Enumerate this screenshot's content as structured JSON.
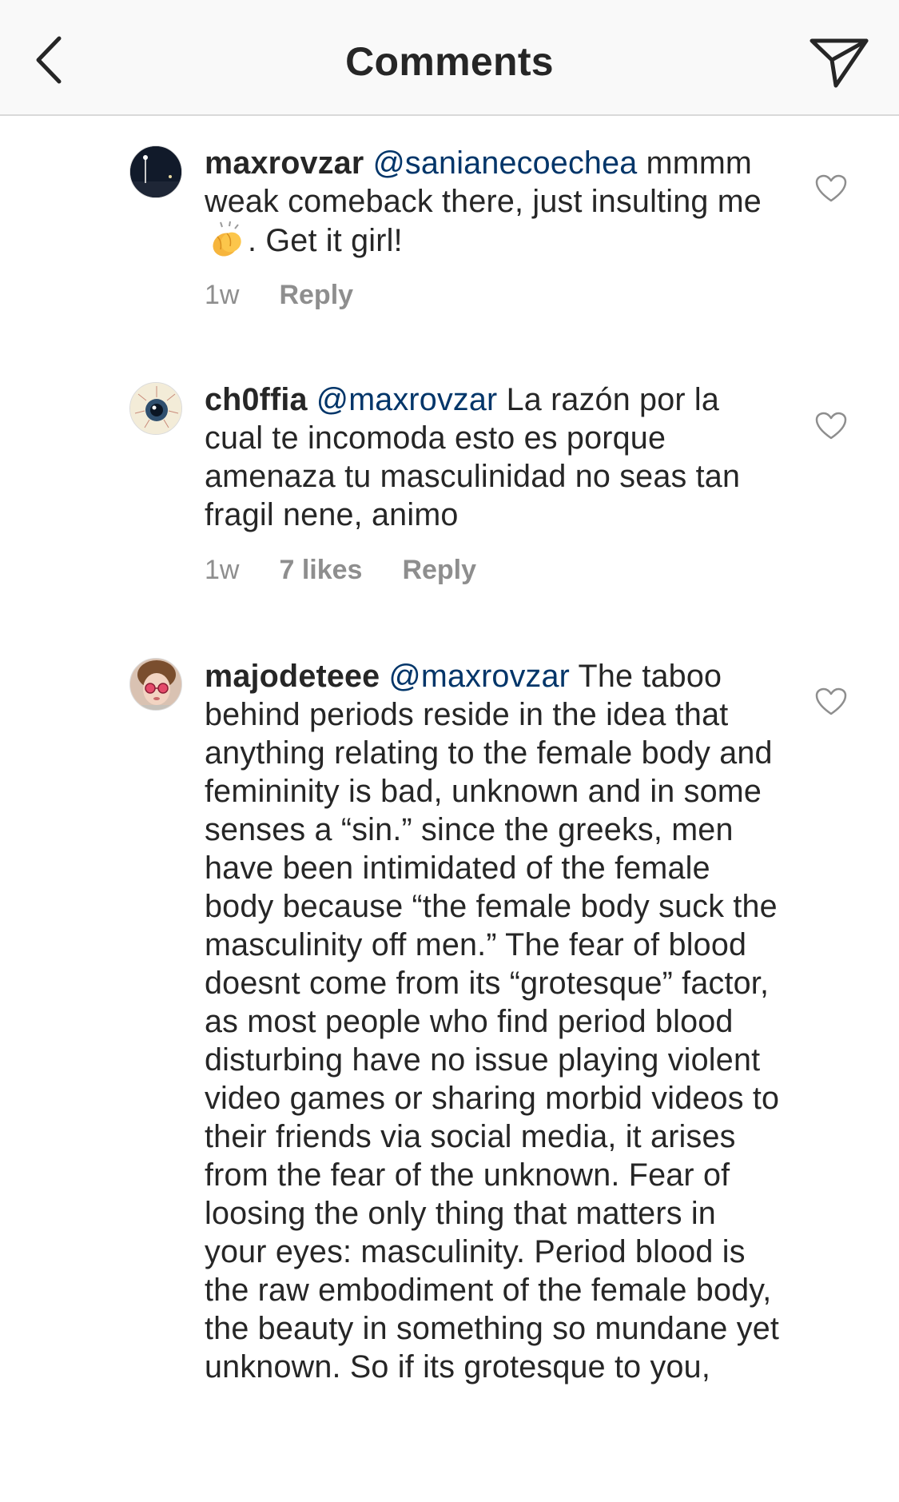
{
  "header": {
    "title": "Comments",
    "back_icon": "chevron-left-icon",
    "send_icon": "paper-plane-icon"
  },
  "comments": [
    {
      "username": "maxrovzar",
      "mention": "@sanianecoechea",
      "text_before": "mmmm weak comeback there, just insulting me",
      "emoji": "clapping-hands-emoji",
      "text_after": ". Get it girl!",
      "time": "1w",
      "reply": "Reply"
    },
    {
      "username": "ch0ffia",
      "mention": "@maxrovzar",
      "text": "La razón por la cual te incomoda esto es porque amenaza tu masculinidad no seas tan fragil nene, animo",
      "time": "1w",
      "likes": "7 likes",
      "reply": "Reply"
    },
    {
      "username": "majodeteee",
      "mention": "@maxrovzar",
      "text": "The taboo behind periods reside in the idea that anything relating to the female body and femininity is bad, unknown and in some senses a “sin.” since the greeks, men have been intimidated of the female body because “the female body suck the masculinity off men.” The fear of blood doesnt come from its “grotesque” factor, as most people who find period blood disturbing have no issue playing violent video games or sharing morbid videos to their friends via social media, it arises from the fear of the unknown. Fear of loosing the only thing that matters in your eyes: masculinity. Period blood is the raw embodiment of the female body, the beauty in something so mundane yet unknown. So if its grotesque to you,"
    }
  ],
  "colors": {
    "text": "#262626",
    "mention": "#003569",
    "meta": "#8e8e8e",
    "header_bg": "#f9f9f9"
  }
}
